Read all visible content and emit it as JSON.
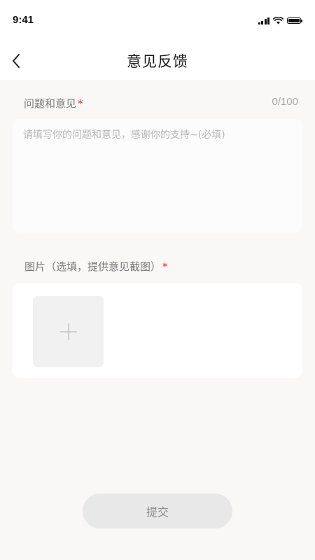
{
  "status_bar": {
    "time": "9:41",
    "icons": [
      "signal-icon",
      "wifi-icon",
      "battery-icon"
    ]
  },
  "nav": {
    "back_icon": "chevron-left-icon",
    "title": "意见反馈"
  },
  "feedback": {
    "label": "问题和意见",
    "required_mark": "*",
    "counter": "0/100",
    "value": "",
    "placeholder": "请填写你的问题和意见，感谢你的支持~(必填)"
  },
  "images": {
    "label": "图片（选填，提供意见截图）",
    "required_mark": "*",
    "add_icon": "plus-icon"
  },
  "submit": {
    "label": "提交"
  },
  "colors": {
    "page_background": "#faf7f7",
    "card_background": "#ffffff",
    "required": "#e0302b",
    "button_background": "#e9e8e8",
    "button_text": "#8d8d8d"
  }
}
